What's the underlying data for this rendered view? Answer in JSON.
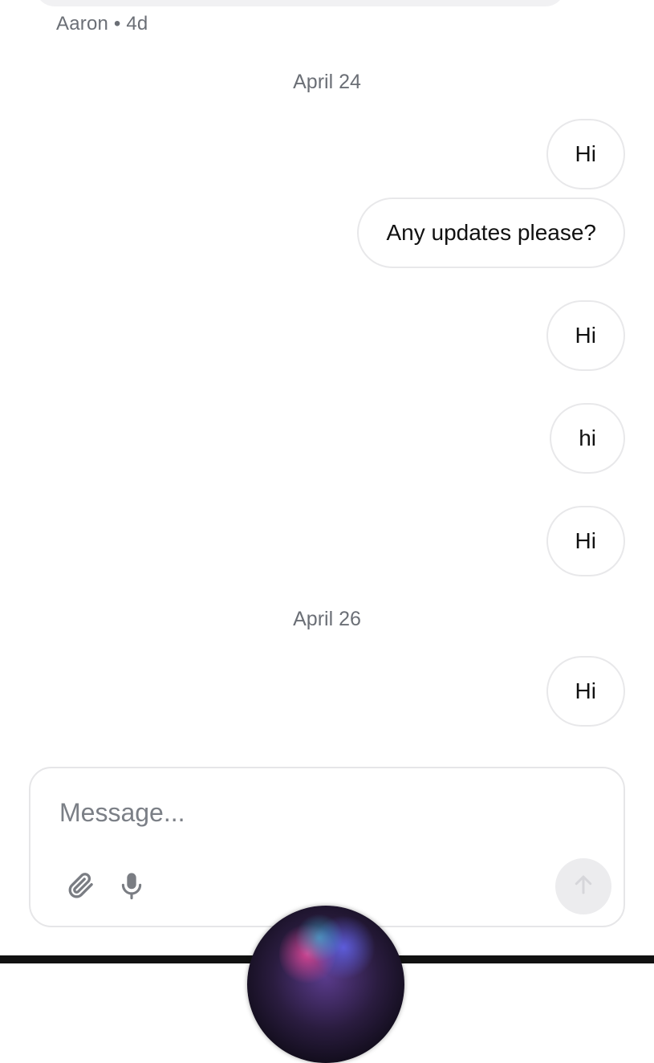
{
  "conversation": {
    "previous_sender_meta": "Aaron • 4d",
    "groups": [
      {
        "date": "April 24",
        "messages": [
          "Hi",
          "Any updates please?",
          "Hi",
          "hi",
          "Hi"
        ]
      },
      {
        "date": "April 26",
        "messages": [
          "Hi"
        ]
      }
    ]
  },
  "composer": {
    "placeholder": "Message...",
    "icons": {
      "attach": "paperclip-icon",
      "voice": "microphone-icon",
      "send": "arrow-up-icon"
    }
  },
  "system": {
    "assistant_orb": "siri-orb"
  }
}
